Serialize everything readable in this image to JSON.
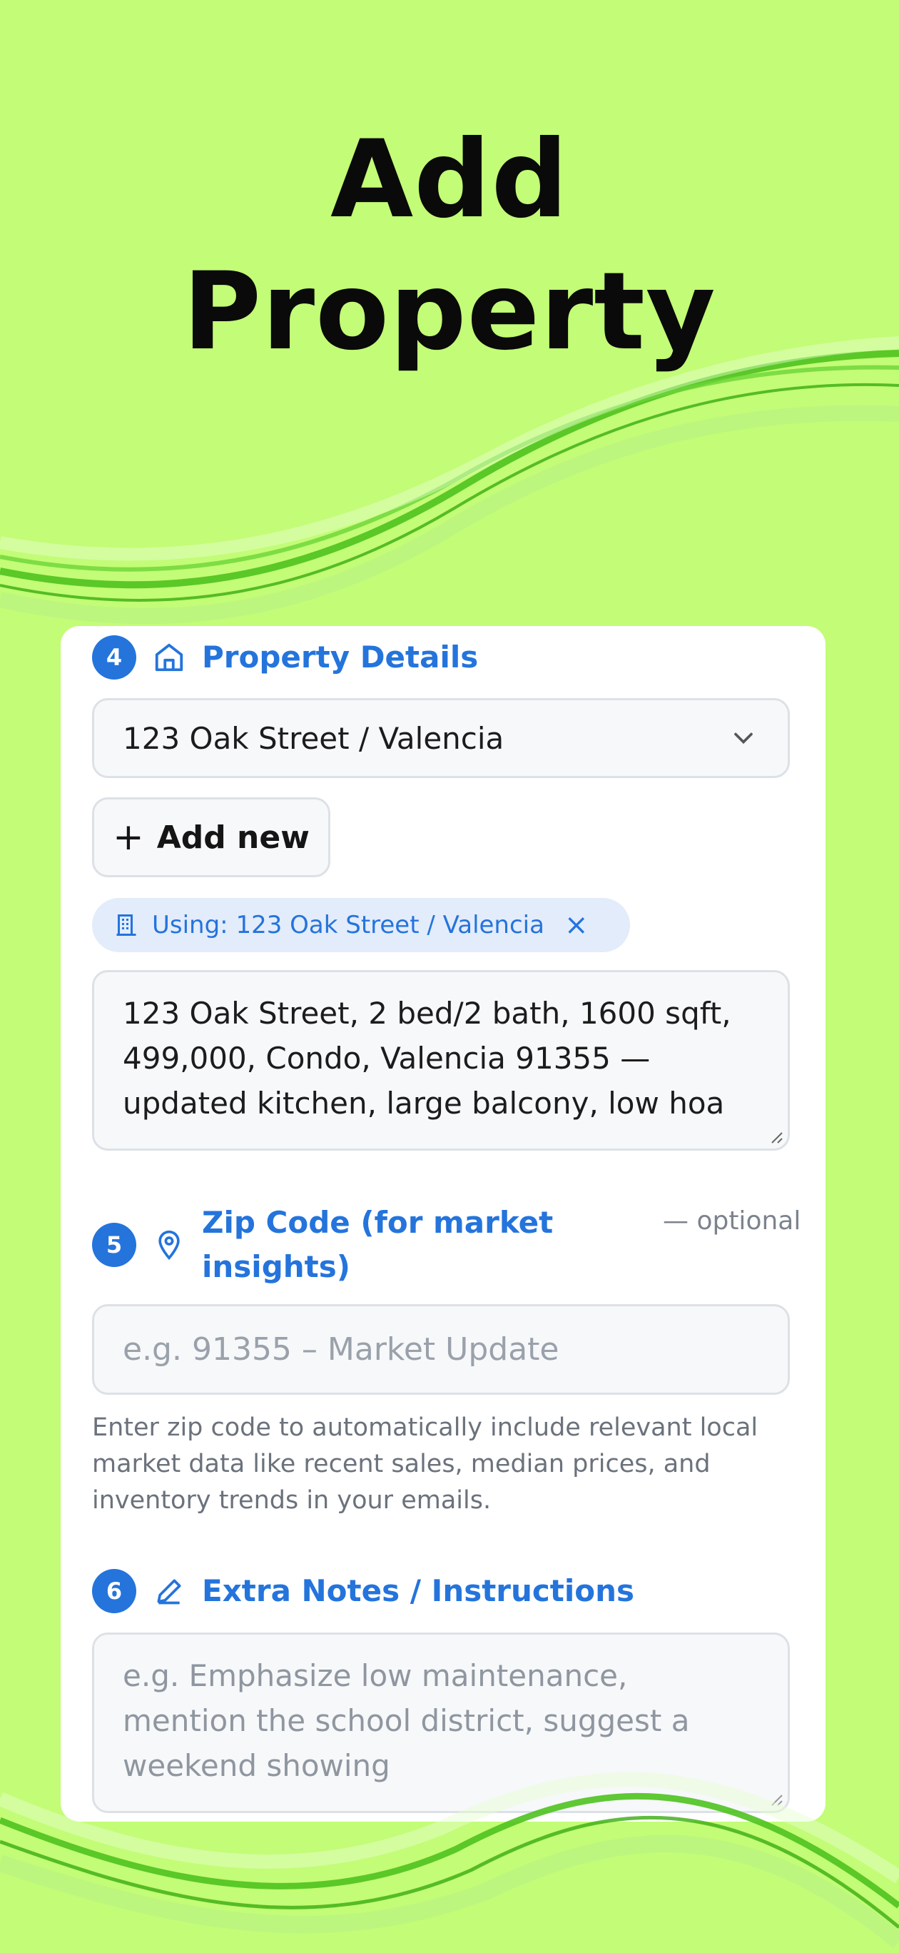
{
  "hero": {
    "line1": "Add",
    "line2": "Property"
  },
  "colors": {
    "background": "#c3fc76",
    "accent": "#2474dc",
    "card": "#ffffff"
  },
  "sections": {
    "property": {
      "step": "4",
      "icon": "home-icon",
      "title": "Property Details",
      "select_value": "123 Oak Street / Valencia",
      "add_new_label": "Add new",
      "chip_label": "Using: 123 Oak Street / Valencia",
      "details_text": "123 Oak Street, 2 bed/2 bath, 1600 sqft, 499,000, Condo, Valencia 91355 — updated kitchen, large balcony, low hoa"
    },
    "zip": {
      "step": "5",
      "icon": "map-pin-icon",
      "title": "Zip Code (for market insights)",
      "optional_label": "— optional",
      "placeholder": "e.g. 91355 – Market Update",
      "helper": "Enter zip code to automatically include relevant local market data like recent sales, median prices, and inventory trends in your emails."
    },
    "notes": {
      "step": "6",
      "icon": "pencil-icon",
      "title": "Extra Notes / Instructions",
      "placeholder": "e.g. Emphasize low maintenance, mention the school district, suggest a weekend showing"
    }
  }
}
